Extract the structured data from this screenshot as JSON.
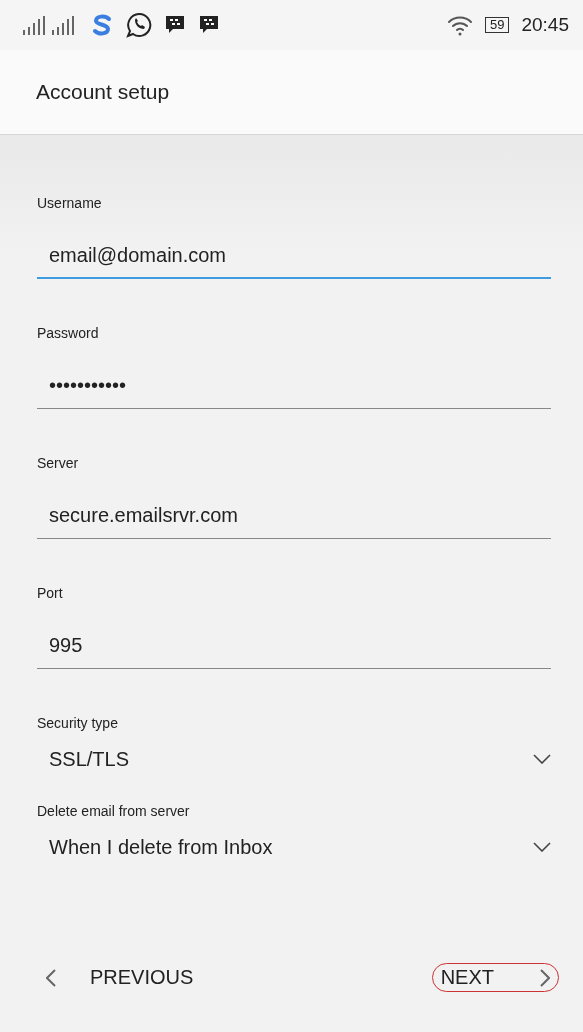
{
  "status_bar": {
    "time": "20:45",
    "battery": "59"
  },
  "header": {
    "title": "Account setup"
  },
  "fields": [
    {
      "kind": "text",
      "label": "Username",
      "value": "email@domain.com",
      "focused": true
    },
    {
      "kind": "text",
      "label": "Password",
      "value": "•••••••••••",
      "focused": false
    },
    {
      "kind": "text",
      "label": "Server",
      "value": "secure.emailsrvr.com",
      "focused": false
    },
    {
      "kind": "text",
      "label": "Port",
      "value": "995",
      "focused": false
    },
    {
      "kind": "select",
      "label": "Security type",
      "value": "SSL/TLS",
      "focused": false
    },
    {
      "kind": "select",
      "label": "Delete email from server",
      "value": "When I delete from Inbox",
      "focused": false
    }
  ],
  "nav": {
    "previous": "PREVIOUS",
    "next": "NEXT"
  }
}
